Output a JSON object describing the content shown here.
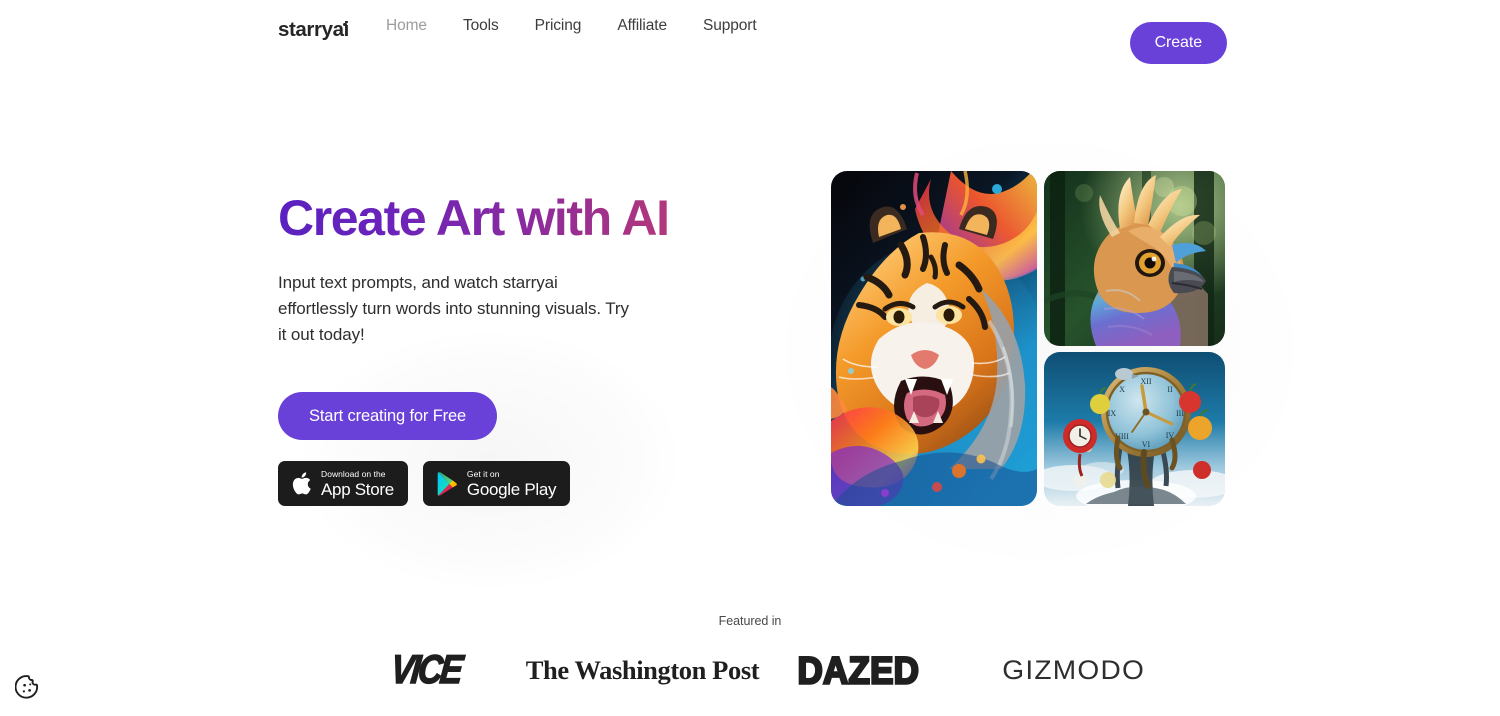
{
  "brand": {
    "logo_text": "starryai",
    "accent_color": "#6941d9"
  },
  "header": {
    "nav": [
      {
        "label": "Home",
        "muted": true
      },
      {
        "label": "Tools",
        "muted": false
      },
      {
        "label": "Pricing",
        "muted": false
      },
      {
        "label": "Affiliate",
        "muted": false
      },
      {
        "label": "Support",
        "muted": false
      }
    ],
    "create_label": "Create"
  },
  "hero": {
    "headline": "Create Art with AI",
    "headline_gradient_from": "#5a21c0",
    "headline_gradient_to": "#c9476e",
    "subhead": "Input text prompts, and watch starryai effortlessly turn words into stunning visuals. Try it out today!",
    "cta_label": "Start creating for Free",
    "stores": [
      {
        "icon": "apple-icon",
        "small_label": "Download on the",
        "big_label": "App Store"
      },
      {
        "icon": "google-play-icon",
        "small_label": "Get it on",
        "big_label": "Google Play"
      }
    ],
    "artworks": [
      {
        "name": "tiger-artwork",
        "alt": "Roaring tiger with colorful paint splash on dark blue background"
      },
      {
        "name": "bird-artwork",
        "alt": "Crested fantasy bird with blue and purple plumage in a forest"
      },
      {
        "name": "clock-artwork",
        "alt": "Surreal melting clock with floating apples in a blue sky"
      }
    ]
  },
  "featured": {
    "label": "Featured in",
    "outlets": [
      {
        "name": "vice",
        "text": "VICE"
      },
      {
        "name": "the-washington-post",
        "text": "The Washington Post"
      },
      {
        "name": "dazed",
        "text": "DAZED"
      },
      {
        "name": "gizmodo",
        "text": "GIZMODO"
      }
    ]
  },
  "cookie": {
    "icon": "cookie-icon",
    "label": "Cookie preferences"
  }
}
